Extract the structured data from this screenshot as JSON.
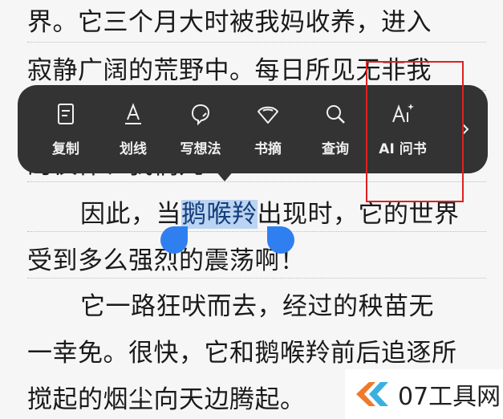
{
  "reader": {
    "line1": "界。它三个月大时被我妈收养，进入",
    "line2": "寂静广阔的荒野中。每日所见无非我",
    "line3": "的伙伴、我们几",
    "line4_pre": "因此，当",
    "line4_selected": "鹅喉羚",
    "line4_post": "出现时，它的世界",
    "line5": "受到多么强烈的震荡啊！",
    "line6": "它一路狂吠而去，经过的秧苗无",
    "line7": "一幸免。很快，它和鹅喉羚前后追逐所",
    "line8": "搅起的烟尘向天边腾起。"
  },
  "toolbar": {
    "items": [
      {
        "label": "复制",
        "icon": "copy-icon"
      },
      {
        "label": "划线",
        "icon": "underline-icon"
      },
      {
        "label": "写想法",
        "icon": "thought-icon"
      },
      {
        "label": "书摘",
        "icon": "bookmark-fan-icon"
      },
      {
        "label": "查询",
        "icon": "search-icon"
      },
      {
        "label": "AI 问书",
        "icon": "ai-icon"
      }
    ],
    "more_icon": "chevron-right-icon"
  },
  "watermark": {
    "text": "07工具网",
    "logo_icon": "arrow-logo-icon"
  },
  "colors": {
    "toolbar_bg": "#333333",
    "selection_bg": "#bcd4f3",
    "handle": "#2f7ff0",
    "highlight_box": "#e02020"
  }
}
